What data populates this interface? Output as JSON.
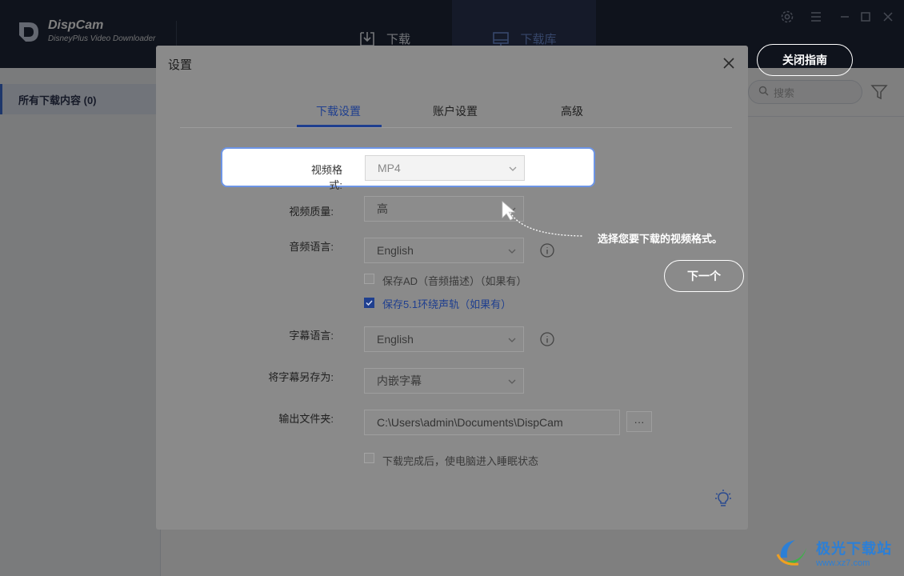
{
  "app": {
    "name": "DispCam",
    "subtitle": "DisneyPlus Video Downloader"
  },
  "nav": {
    "download": "下载",
    "library": "下载库"
  },
  "sidebar": {
    "items": [
      {
        "label": "所有下载内容 (0)"
      }
    ]
  },
  "search": {
    "placeholder": "搜索"
  },
  "dialog": {
    "title": "设置",
    "tabs": [
      {
        "label": "下载设置",
        "active": true
      },
      {
        "label": "账户设置",
        "active": false
      },
      {
        "label": "高级",
        "active": false
      }
    ],
    "video_format": {
      "label": "视频格式:",
      "value": "MP4"
    },
    "video_quality": {
      "label": "视频质量:",
      "value": "高"
    },
    "audio_language": {
      "label": "音频语言:",
      "value": "English"
    },
    "save_ad": {
      "label": "保存AD（音频描述）（如果有）",
      "checked": false
    },
    "save_51": {
      "label": "保存5.1环绕声轨（如果有）",
      "checked": true
    },
    "subtitle_language": {
      "label": "字幕语言:",
      "value": "English"
    },
    "save_subtitle_as": {
      "label": "将字幕另存为:",
      "value": "内嵌字幕"
    },
    "output_folder": {
      "label": "输出文件夹:",
      "value": "C:\\Users\\admin\\Documents\\DispCam",
      "browse": "···"
    },
    "sleep_after": {
      "label": "下载完成后，使电脑进入睡眠状态",
      "checked": false
    }
  },
  "guide": {
    "close_label": "关闭指南",
    "message": "选择您要下载的视频格式。",
    "next_label": "下一个"
  },
  "watermark": {
    "name": "极光下载站",
    "url": "www.xz7.com"
  },
  "colors": {
    "titlebar": "#1f2739",
    "accent": "#3d6fd6",
    "highlight_border": "#6d95e6"
  }
}
